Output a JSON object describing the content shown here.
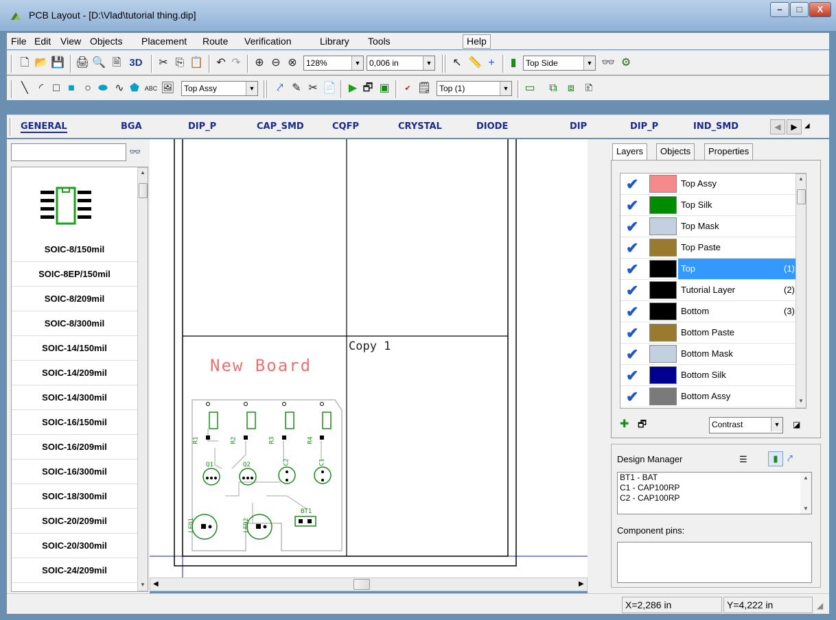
{
  "window": {
    "title": "PCB Layout - [D:\\Vlad\\tutorial thing.dip]",
    "min": "–",
    "max": "□",
    "close": "X"
  },
  "menu": [
    "File",
    "Edit",
    "View",
    "Objects",
    "Placement",
    "Route",
    "Verification",
    "Library",
    "Tools",
    "Help"
  ],
  "toolbar1": {
    "zoom": "128%",
    "grid": "0,006 in",
    "threeD": "3D",
    "side": "Top Side"
  },
  "toolbar2": {
    "layer_select": "Top Assy",
    "abc_label": "ABC",
    "layer_num": "Top (1)"
  },
  "library_tabs": [
    "GENERAL",
    "BGA",
    "DIP_P",
    "CAP_SMD",
    "CQFP",
    "CRYSTAL",
    "DIODE",
    "DIP",
    "DIP_P",
    "IND_SMD"
  ],
  "library": {
    "search": "",
    "items": [
      "SOIC-8/150mil",
      "SOIC-8EP/150mil",
      "SOIC-8/209mil",
      "SOIC-8/300mil",
      "SOIC-14/150mil",
      "SOIC-14/209mil",
      "SOIC-14/300mil",
      "SOIC-16/150mil",
      "SOIC-16/209mil",
      "SOIC-16/300mil",
      "SOIC-18/300mil",
      "SOIC-20/209mil",
      "SOIC-20/300mil",
      "SOIC-24/209mil"
    ]
  },
  "canvas": {
    "board_title": "New Board",
    "copy_label": "Copy 1",
    "resistors": [
      "R1",
      "R2",
      "R3",
      "R4"
    ],
    "parts": [
      "Q1",
      "Q2",
      "C2",
      "C1"
    ],
    "leds": [
      "LED1",
      "LED2"
    ],
    "battery": "BT1"
  },
  "right_tabs": [
    "Layers",
    "Objects",
    "Properties"
  ],
  "layers": [
    {
      "name": "Top Assy",
      "num": "",
      "color": "#f48a8a",
      "selected": false
    },
    {
      "name": "Top Silk",
      "num": "",
      "color": "#008c00",
      "selected": false
    },
    {
      "name": "Top Mask",
      "num": "",
      "color": "#c3d0e0",
      "selected": false
    },
    {
      "name": "Top Paste",
      "num": "",
      "color": "#9a7a2c",
      "selected": false
    },
    {
      "name": "Top",
      "num": "(1)",
      "color": "#000000",
      "selected": true
    },
    {
      "name": "Tutorial Layer",
      "num": "(2)",
      "color": "#000000",
      "selected": false
    },
    {
      "name": "Bottom",
      "num": "(3)",
      "color": "#000000",
      "selected": false
    },
    {
      "name": "Bottom Paste",
      "num": "",
      "color": "#9a7a2c",
      "selected": false
    },
    {
      "name": "Bottom Mask",
      "num": "",
      "color": "#c3d0e0",
      "selected": false
    },
    {
      "name": "Bottom Silk",
      "num": "",
      "color": "#000090",
      "selected": false
    },
    {
      "name": "Bottom Assy",
      "num": "",
      "color": "#7a7a7a",
      "selected": false
    }
  ],
  "contrast": "Contrast",
  "design_manager": {
    "title": "Design Manager",
    "components": [
      "BT1 - BAT",
      "C1 - CAP100RP",
      "C2 - CAP100RP"
    ],
    "pins_label": "Component pins:"
  },
  "status": {
    "x": "X=2,286 in",
    "y": "Y=4,222 in"
  }
}
